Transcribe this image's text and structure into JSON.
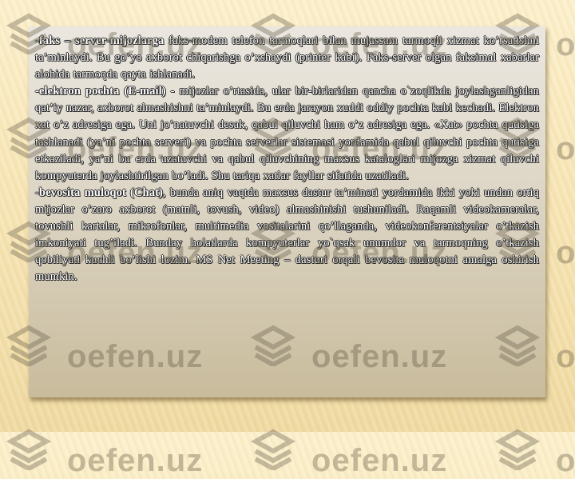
{
  "watermark": {
    "text": "oefen.uz",
    "icon": "stacked-chevron-logo-icon"
  },
  "content": {
    "paragraphs": [
      {
        "lead": "-faks – server-mijozlarga",
        "text": " faks-modem telefon tarmoqlari bilan mujassam tarmoqli xizmat ko’rsatishni ta’minlaydi. Bu go’yo axborot chiqarishga o’xshaydi (printer kabi). Faks-server olgan faksimal xabarlar alohida tarmoqda qayta ishlanadi."
      },
      {
        "lead": "-elektron pochta (E-mail)",
        "text": " - mijozlar o’rtasida, ular bir-birlaridan qancha o`zoqlikda joylashganligidan qat’iy nazar, axborot almashishni ta’minlaydi. Bu erda jarayon xuddi oddiy pochta kabi kechadi. Elektron xat o’z adresiga ega. Uni jo’natuvchi desak, qabul qiluvchi ham o’z adresiga ega. «Xat» pochta qutisiga tashlanadi (ya’ni pochta serveri) va pochta serverlar sistemasi yordamida qabul qiluvchi pochta qutisiga etkaziladi, ya’ni bu erda uzatuvchi va qabul qiluvchining maxsus kataloglari mijozga xizmat qiluvchi kompyuterda joylashtirilgan bo’ladi. Shu tariqa xatlar fayllar sifatida uzatiladi."
      },
      {
        "lead": "-bevosita muloqot (Chat)",
        "text": ", bunda aniq vaqtda maxsus dastur ta’minoti yordamida ikki yoki undan ortiq mijozlar o’zaro axborot (matnli, tovush, video) almashinishi tushuniladi. Raqamli videokameralar, tovushli kartalar, mikrofonlar, multimedia vositalarini qo’llaganda, videokonferentsiyalar o’tkazish imkoniyati tug’iladi. Bunday holatlarda kompyuterlar yo`qsak unumdor va tarmoqning o’tkazish qobiliyati kuchli bo’lishi lozim. MS Net Meeting – dasturi orqali bevosita muloqotni amalga oshirish mumkin."
      }
    ]
  }
}
